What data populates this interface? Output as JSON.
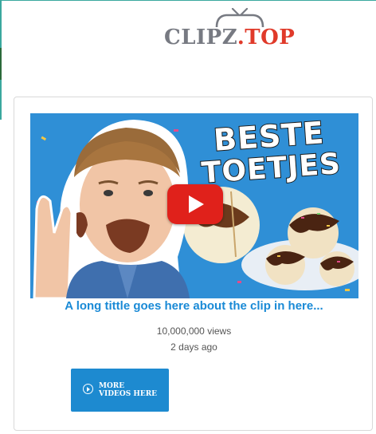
{
  "logo": {
    "brand": "CLIPZ",
    "dot": ".",
    "tld": "TOP",
    "icon": "tv-icon"
  },
  "clip": {
    "thumbnail_text_line1": "BESTE",
    "thumbnail_text_line2": "TOETJES",
    "play_icon": "play-icon",
    "title": "A long tittle goes here about the clip in here...",
    "views": "10,000,000 views",
    "age": "2 days ago"
  },
  "more_button": {
    "icon": "play-circle-icon",
    "line1": "MORE",
    "line2": "VIDEOS HERE"
  },
  "colors": {
    "link": "#1a8ad6",
    "button": "#1d8ad0",
    "play": "#e0211b",
    "logo_gray": "#777a82",
    "logo_red": "#e03a2a"
  }
}
